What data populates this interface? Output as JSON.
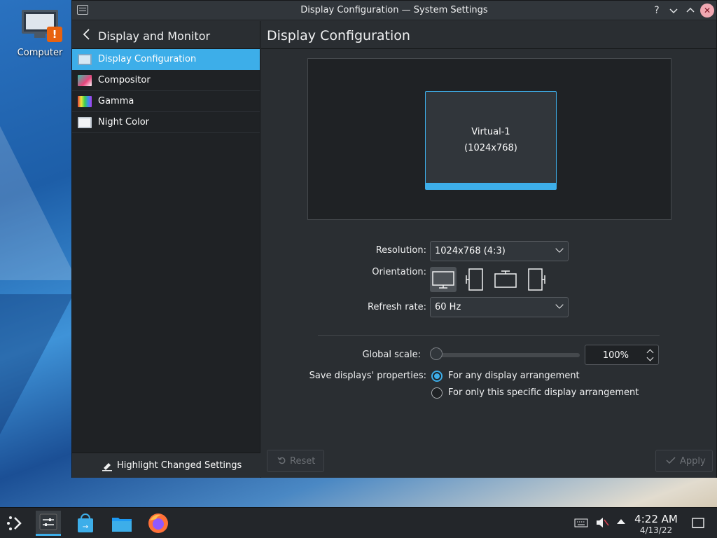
{
  "desktop": {
    "computer_icon_label": "Computer"
  },
  "window": {
    "title": "Display Configuration — System Settings",
    "help_glyph": "?",
    "minimize_glyph": "⌄",
    "maximize_glyph": "⌃",
    "close_glyph": "✕"
  },
  "sidebar": {
    "header": "Display and Monitor",
    "items": [
      {
        "label": "Display Configuration",
        "icon": "display-icon",
        "active": true
      },
      {
        "label": "Compositor",
        "icon": "compositor-icon",
        "active": false
      },
      {
        "label": "Gamma",
        "icon": "gamma-icon",
        "active": false
      },
      {
        "label": "Night Color",
        "icon": "night-color-icon",
        "active": false
      }
    ],
    "highlight_button": "Highlight Changed Settings"
  },
  "content": {
    "title": "Display Configuration",
    "preview": {
      "output_name": "Virtual-1",
      "output_resolution": "(1024x768)"
    },
    "resolution_label": "Resolution:",
    "resolution_value": "1024x768 (4:3)",
    "orientation_label": "Orientation:",
    "orientation_options": [
      "landscape",
      "portrait-left",
      "landscape-flipped",
      "portrait-right"
    ],
    "orientation_selected": "landscape",
    "refresh_label": "Refresh rate:",
    "refresh_value": "60 Hz",
    "scale_label": "Global scale:",
    "scale_value": "100%",
    "scale_slider_fraction": 0,
    "save_label": "Save displays' properties:",
    "save_options": [
      {
        "label": "For any display arrangement",
        "selected": true
      },
      {
        "label": "For only this specific display arrangement",
        "selected": false
      }
    ],
    "reset_button": "Reset",
    "apply_button": "Apply"
  },
  "taskbar": {
    "time": "4:22 AM",
    "date": "4/13/22"
  },
  "colors": {
    "accent": "#3daee9",
    "window_bg": "#2a2e32",
    "sidebar_bg": "#1f2225"
  }
}
